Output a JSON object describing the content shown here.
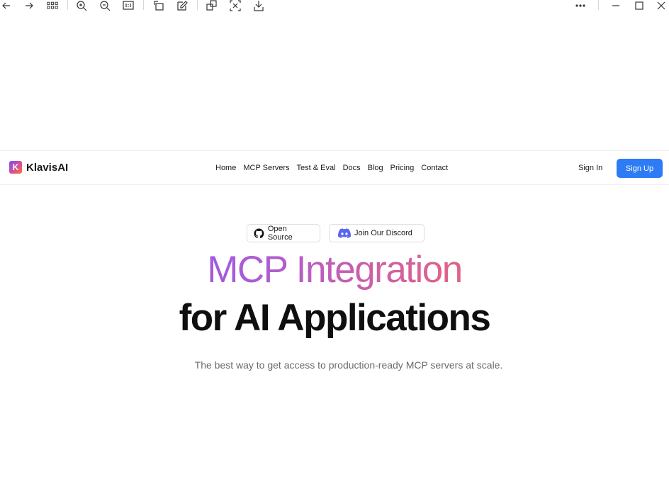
{
  "viewer_toolbar": {
    "icons": [
      "back-arrow-icon",
      "forward-arrow-icon",
      "grid-view-icon",
      "zoom-in-icon",
      "zoom-out-icon",
      "actual-size-icon",
      "rotate-icon",
      "edit-icon",
      "copy-icon",
      "fit-screen-icon",
      "save-icon",
      "more-icon",
      "minimize-icon",
      "maximize-icon",
      "close-icon"
    ]
  },
  "nav": {
    "brand": "KlavisAI",
    "brand_logo_letter": "K",
    "links": [
      "Home",
      "MCP Servers",
      "Test & Eval",
      "Docs",
      "Blog",
      "Pricing",
      "Contact"
    ],
    "sign_in": "Sign In",
    "sign_up": "Sign Up"
  },
  "hero": {
    "badge_open_source": "Open Source",
    "badge_discord": "Join Our Discord",
    "headline_part1": "MCP Integration",
    "headline_part2": "for AI Applications",
    "subtitle": "The best way to get access to production-ready MCP servers at scale."
  },
  "colors": {
    "accent": "#2d7cf6",
    "gradient_start": "#8a4cf0",
    "gradient_end": "#f2702a",
    "discord": "#5865f2"
  }
}
